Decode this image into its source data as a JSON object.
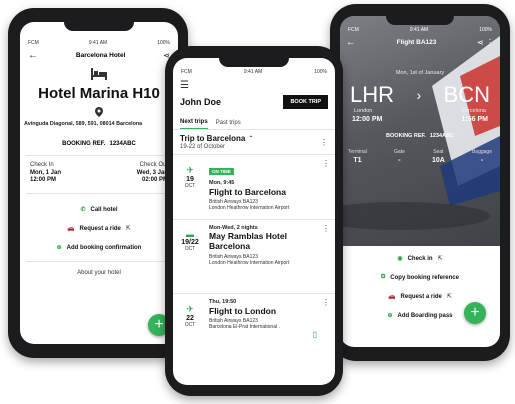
{
  "status": {
    "carrier": "FCM",
    "time": "9:41 AM",
    "battery": "100%"
  },
  "hotel": {
    "title": "Barcelona Hotel",
    "name": "Hotel Marina H10",
    "address": "Avinguda Diagonal, 589, 591, 08014 Barcelona",
    "booking_ref_label": "BOOKING REF.",
    "booking_ref": "1234ABC",
    "checkin_label": "Check In",
    "checkin_date": "Mon, 1 Jan",
    "checkin_time": "12:00 PM",
    "checkout_label": "Check Out",
    "checkout_date": "Wed, 3 Jan",
    "checkout_time": "02:00 PM",
    "actions": [
      "Call hotel",
      "Request a ride",
      "Add booking confirmation"
    ],
    "about": "About your hotel"
  },
  "trips": {
    "user": "John Doe",
    "book_button": "BOOK TRIP",
    "tabs": [
      "Next trips",
      "Past trips"
    ],
    "trip_title": "Trip to Barcelona",
    "trip_dates": "19-22 of October",
    "cards": [
      {
        "day": "19",
        "month": "OCT",
        "badge": "ON TIME",
        "when": "Mon, 9:45",
        "title": "Flight to Barcelona",
        "line1": "British Airways BA123",
        "line2": "London Heathrow Internation Airport"
      },
      {
        "day": "19/22",
        "month": "OCT",
        "when": "Mon-Wed, 2 nights",
        "title": "May Ramblas Hotel Barcelona",
        "line1": "British Airways BA123",
        "line2": "London Heathrow Internation Airport"
      },
      {
        "day": "22",
        "month": "OCT",
        "when": "Thu, 19:50",
        "title": "Flight to London",
        "line1": "British Airways BA123",
        "line2": "Barcelona El-Prat International ."
      }
    ]
  },
  "flight": {
    "title": "Flight BA123",
    "date": "Mon, 1st of January",
    "from_code": "LHR",
    "to_code": "BCN",
    "from_city": "London",
    "to_city": "Barcelona",
    "from_time": "12:00 PM",
    "to_time": "1:56 PM",
    "booking_ref_label": "BOOKING REF.",
    "booking_ref": "1234ABC",
    "details": [
      {
        "label": "Terminal",
        "value": "T1"
      },
      {
        "label": "Gate",
        "value": "-"
      },
      {
        "label": "Seat",
        "value": "10A"
      },
      {
        "label": "Baggage",
        "value": "-"
      }
    ],
    "actions": [
      "Check in",
      "Copy booking reference",
      "Request a ride",
      "Add Boarding pass"
    ]
  },
  "colors": {
    "accent": "#34b35a",
    "dark": "#1c1c1e"
  }
}
